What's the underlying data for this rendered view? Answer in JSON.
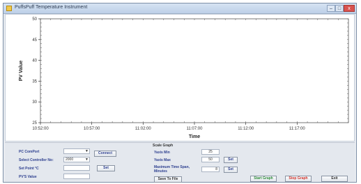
{
  "window": {
    "title": "PuffsPuff Temperature Instrument",
    "controls": {
      "minimize": "–",
      "maximize": "□",
      "close": "x"
    }
  },
  "chart_data": {
    "type": "line",
    "title": "",
    "xlabel": "Time",
    "ylabel": "PV Value",
    "ylim": [
      25,
      50
    ],
    "yticks": [
      "25",
      "30",
      "35",
      "40",
      "45",
      "50"
    ],
    "xticks": [
      "10:52:00",
      "10:57:00",
      "11:02:00",
      "11:07:00",
      "11:12:00",
      "11:17:00"
    ],
    "xrange_minutes": [
      0,
      30
    ],
    "xtick_minutes": [
      0,
      5,
      10,
      15,
      20,
      25
    ],
    "grid": false,
    "series": []
  },
  "controls": {
    "pc_comport_label": "PC ComPort",
    "pc_comport_value": "",
    "connect_label": "Connect",
    "select_controller_label": "Select Controller No:",
    "select_controller_value": "2000",
    "set_point_label": "Set Point °C",
    "set_point_value": "",
    "set_label": "Set",
    "pv_value_label": "PV'S Value",
    "pv_value_value": "",
    "scale_group_title": "Scale Graph",
    "ymin_label": "Yaxis Min",
    "ymin_value": "25",
    "ymax_label": "Yaxis Max",
    "ymax_value": "50",
    "ymax_set_label": "Set",
    "timespan_label": "Maximum Time Span, Minutes",
    "timespan_value": "8",
    "timespan_set_label": "Set",
    "save_label": "Save To File",
    "start_graph_label": "Start Graph",
    "stop_graph_label": "Stop Graph",
    "exit_label": "Exit"
  }
}
